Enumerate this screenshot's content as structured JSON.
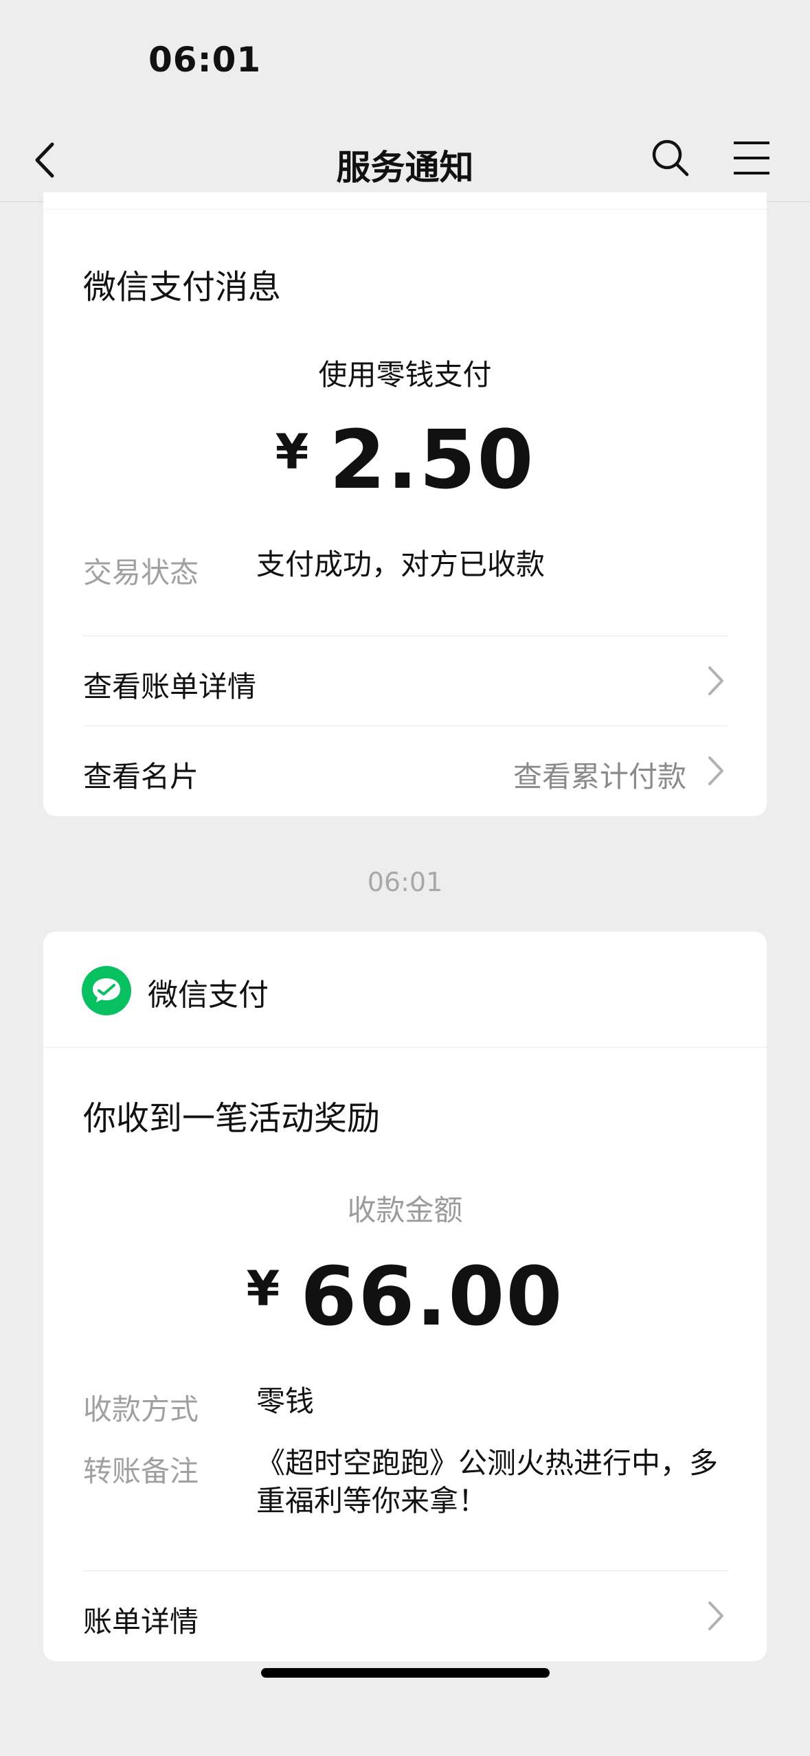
{
  "status_bar": {
    "time": "06:01"
  },
  "nav": {
    "title": "服务通知"
  },
  "card1": {
    "title": "微信支付消息",
    "subtitle": "使用零钱支付",
    "currency": "¥",
    "amount": "2.50",
    "status_label": "交易状态",
    "status_value": "支付成功，对方已收款",
    "row1_label": "查看账单详情",
    "row2_label": "查看名片",
    "row2_extra": "查看累计付款"
  },
  "timestamp": "06:01",
  "card2": {
    "brand": "微信支付",
    "title": "你收到一笔活动奖励",
    "subtitle": "收款金额",
    "currency": "¥",
    "amount": "66.00",
    "method_label": "收款方式",
    "method_value": "零钱",
    "note_label": "转账备注",
    "note_value": "《超时空跑跑》公测火热进行中，多重福利等你来拿！",
    "row_label": "账单详情"
  },
  "colors": {
    "wechat_green": "#07c160",
    "background": "#ededed"
  },
  "icons": [
    "back-arrow-icon",
    "search-icon",
    "menu-icon",
    "chevron-right-icon",
    "wechat-pay-icon"
  ]
}
